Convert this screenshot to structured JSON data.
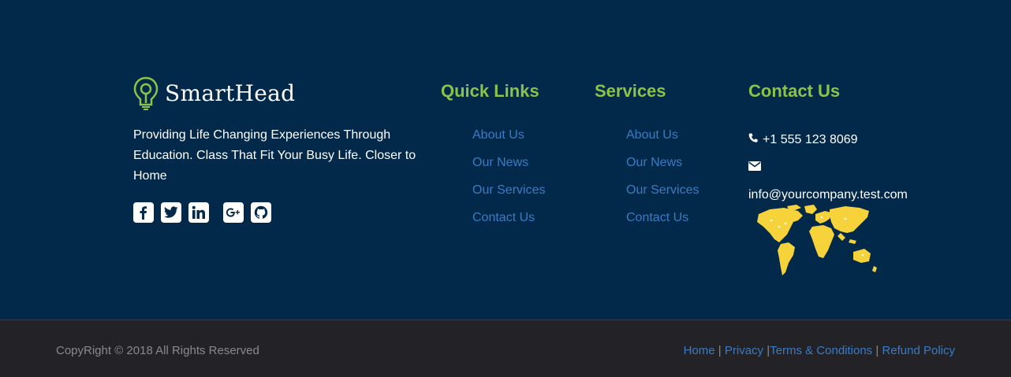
{
  "brand": {
    "name": "SmartHead",
    "tagline": "Providing Life Changing Experiences Through Education. Class That Fit Your Busy Life. Closer to Home",
    "accent_color": "#8bc24a"
  },
  "socials": [
    {
      "icon": "facebook-icon",
      "glyph": "f"
    },
    {
      "icon": "twitter-icon",
      "glyph": "t"
    },
    {
      "icon": "linkedin-icon",
      "glyph": "in"
    },
    {
      "icon": "google-plus-icon",
      "glyph": "G+"
    },
    {
      "icon": "github-icon",
      "glyph": "gh"
    }
  ],
  "quick_links": {
    "title": "Quick Links",
    "items": [
      "About Us",
      "Our News",
      "Our Services",
      "Contact Us"
    ]
  },
  "services": {
    "title": "Services",
    "items": [
      "About Us",
      "Our News",
      "Our Services",
      "Contact Us"
    ]
  },
  "contact": {
    "title": "Contact Us",
    "phone": "+1 555 123 8069",
    "email": "info@yourcompany.test.com"
  },
  "bottom": {
    "copyright": "CopyRight © 2018 All Rights Reserved",
    "links": [
      "Home",
      "Privacy",
      "Terms & Conditions",
      "Refund Policy"
    ]
  },
  "colors": {
    "footer_bg": "#03294a",
    "bottom_bg": "#232227",
    "heading": "#8bc24a",
    "link": "#3a7bc4",
    "map": "#f6d33a"
  }
}
